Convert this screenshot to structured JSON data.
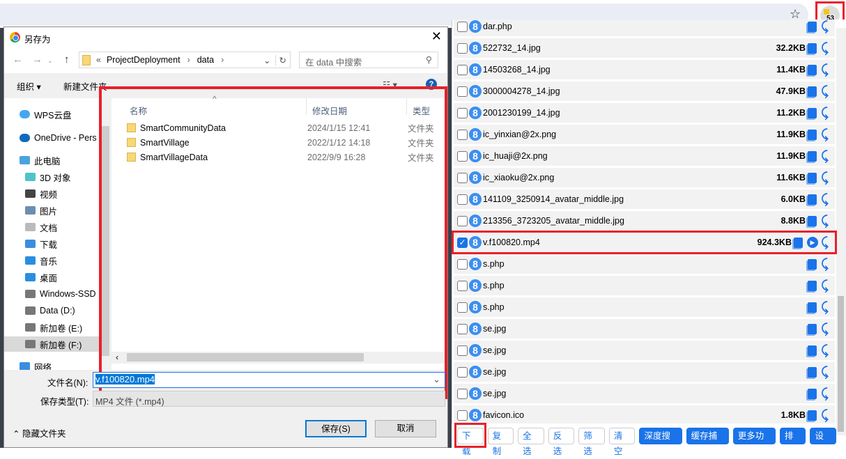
{
  "browser": {
    "extension_badge": "53"
  },
  "dialog": {
    "title": "另存为",
    "path": [
      "ProjectDeployment",
      "data"
    ],
    "path_prefix": "«",
    "search_placeholder": "在 data 中搜索",
    "toolbar": {
      "organize": "组织 ▾",
      "new_folder": "新建文件夹"
    },
    "tree": [
      {
        "label": "WPS云盘",
        "icon": "cloud-icon"
      },
      {
        "label": "OneDrive - Pers",
        "icon": "onedrive-icon"
      },
      {
        "label": "此电脑",
        "icon": "computer-icon"
      },
      {
        "label": "3D 对象",
        "icon": "3d-objects-icon"
      },
      {
        "label": "视频",
        "icon": "video-icon"
      },
      {
        "label": "图片",
        "icon": "picture-icon"
      },
      {
        "label": "文档",
        "icon": "document-icon"
      },
      {
        "label": "下载",
        "icon": "download-icon"
      },
      {
        "label": "音乐",
        "icon": "music-icon"
      },
      {
        "label": "桌面",
        "icon": "desktop-icon"
      },
      {
        "label": "Windows-SSD",
        "icon": "drive-icon"
      },
      {
        "label": "Data (D:)",
        "icon": "drive-icon"
      },
      {
        "label": "新加卷 (E:)",
        "icon": "drive-icon"
      },
      {
        "label": "新加卷 (F:)",
        "icon": "drive-icon",
        "selected": true
      },
      {
        "label": "网络",
        "icon": "network-icon"
      }
    ],
    "columns": [
      "名称",
      "修改日期",
      "类型"
    ],
    "files": [
      {
        "name": "SmartCommunityData",
        "date": "2024/1/15 12:41",
        "type": "文件夹"
      },
      {
        "name": "SmartVillage",
        "date": "2022/1/12 14:18",
        "type": "文件夹"
      },
      {
        "name": "SmartVillageData",
        "date": "2022/9/9 16:28",
        "type": "文件夹"
      }
    ],
    "filename_label": "文件名(N):",
    "filename_value": "v.f100820.mp4",
    "filetype_label": "保存类型(T):",
    "filetype_value": "MP4 文件 (*.mp4)",
    "hide_folders": "隐藏文件夹",
    "save": "保存(S)",
    "cancel": "取消"
  },
  "panel": {
    "items": [
      {
        "name": "dar.php",
        "size": ""
      },
      {
        "name": "522732_14.jpg",
        "size": "32.2KB"
      },
      {
        "name": "14503268_14.jpg",
        "size": "11.4KB"
      },
      {
        "name": "3000004278_14.jpg",
        "size": "47.9KB"
      },
      {
        "name": "2001230199_14.jpg",
        "size": "11.2KB"
      },
      {
        "name": "ic_yinxian@2x.png",
        "size": "11.9KB"
      },
      {
        "name": "ic_huaji@2x.png",
        "size": "11.9KB"
      },
      {
        "name": "ic_xiaoku@2x.png",
        "size": "11.6KB"
      },
      {
        "name": "141109_3250914_avatar_middle.jpg",
        "size": "6.0KB"
      },
      {
        "name": "213356_3723205_avatar_middle.jpg",
        "size": "8.8KB"
      },
      {
        "name": "v.f100820.mp4",
        "size": "924.3KB",
        "checked": true,
        "playable": true
      },
      {
        "name": "s.php",
        "size": ""
      },
      {
        "name": "s.php",
        "size": ""
      },
      {
        "name": "s.php",
        "size": ""
      },
      {
        "name": "se.jpg",
        "size": ""
      },
      {
        "name": "se.jpg",
        "size": ""
      },
      {
        "name": "se.jpg",
        "size": ""
      },
      {
        "name": "se.jpg",
        "size": ""
      },
      {
        "name": "favicon.ico",
        "size": "1.8KB"
      }
    ],
    "buttons": [
      {
        "label": "下载",
        "primary": false
      },
      {
        "label": "复制",
        "primary": false
      },
      {
        "label": "全选",
        "primary": false
      },
      {
        "label": "反选",
        "primary": false
      },
      {
        "label": "筛选",
        "primary": false
      },
      {
        "label": "清空",
        "primary": false
      },
      {
        "label": "深度搜索",
        "primary": true
      },
      {
        "label": "缓存捕捉",
        "primary": true
      },
      {
        "label": "更多功能",
        "primary": true
      },
      {
        "label": "排序",
        "primary": true
      },
      {
        "label": "设置",
        "primary": true
      }
    ],
    "accent": "#1a73e8",
    "highlight": "#e8202a"
  }
}
